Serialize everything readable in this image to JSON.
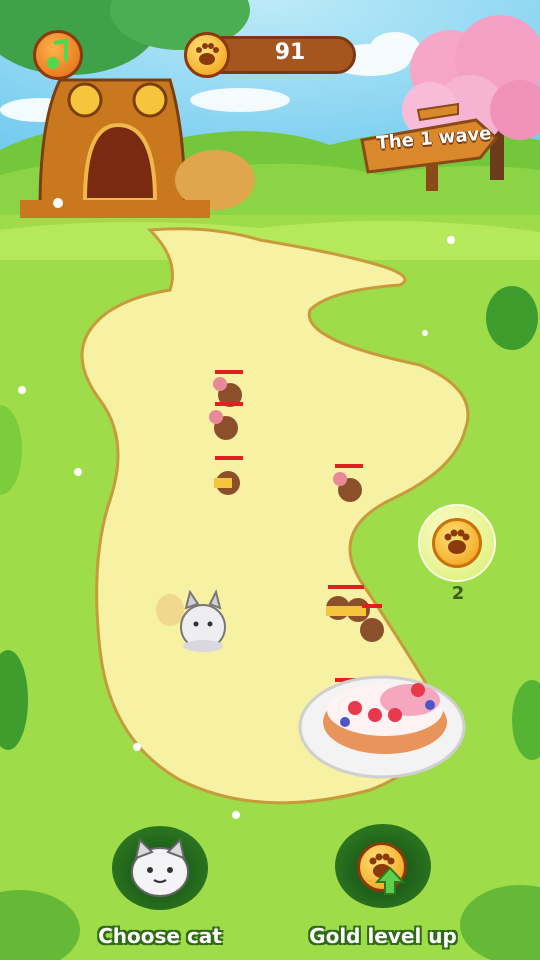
{
  "hud": {
    "coins": "91",
    "music_icon": "music-note-icon",
    "coin_icon": "paw-coin-icon"
  },
  "wave_sign": {
    "text": "The 1 wave"
  },
  "pickup": {
    "icon": "paw-coin-icon",
    "count": "2"
  },
  "actions": {
    "choose_cat_label": "Choose cat",
    "gold_level_up_label": "Gold level up",
    "choose_cat_icon": "cat-face-icon",
    "gold_level_up_icon": "paw-coin-upgrade-icon"
  },
  "units": {
    "mice_count": 8,
    "cats_on_field": 1,
    "goal": "cake"
  },
  "colors": {
    "grass": "#9fdc4a",
    "path": "#f7f1a3",
    "coin_gold": "#f7b81b",
    "counter_brown": "#a5561f"
  }
}
